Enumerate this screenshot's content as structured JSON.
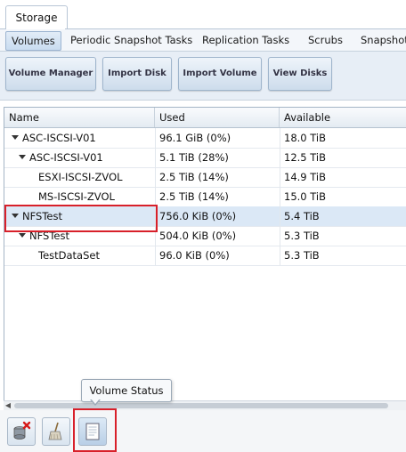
{
  "outer_tab": {
    "label": "Storage"
  },
  "sub_tabs": [
    {
      "label": "Volumes",
      "active": true
    },
    {
      "label": "Periodic Snapshot Tasks",
      "active": false
    },
    {
      "label": "Replication Tasks",
      "active": false
    },
    {
      "label": "Scrubs",
      "active": false
    },
    {
      "label": "Snapshots",
      "active": false
    }
  ],
  "toolbar": {
    "buttons": [
      {
        "label": "Volume Manager"
      },
      {
        "label": "Import Disk"
      },
      {
        "label": "Import Volume"
      },
      {
        "label": "View Disks"
      }
    ]
  },
  "grid": {
    "columns": [
      "Name",
      "Used",
      "Available"
    ],
    "rows": [
      {
        "name": "ASC-ISCSI-V01",
        "used": "96.1 GiB (0%)",
        "available": "18.0 TiB",
        "expander": true,
        "selected": false
      },
      {
        "name": "ASC-ISCSI-V01",
        "used": "5.1 TiB (28%)",
        "available": "12.5 TiB",
        "expander": true,
        "selected": false
      },
      {
        "name": "ESXI-ISCSI-ZVOL",
        "used": "2.5 TiB (14%)",
        "available": "14.9 TiB",
        "expander": false,
        "selected": false
      },
      {
        "name": "MS-ISCSI-ZVOL",
        "used": "2.5 TiB (14%)",
        "available": "15.0 TiB",
        "expander": false,
        "selected": false
      },
      {
        "name": "NFSTest",
        "used": "756.0 KiB (0%)",
        "available": "5.4 TiB",
        "expander": true,
        "selected": true
      },
      {
        "name": "NFSTest",
        "used": "504.0 KiB (0%)",
        "available": "5.3 TiB",
        "expander": true,
        "selected": false
      },
      {
        "name": "TestDataSet",
        "used": "96.0 KiB (0%)",
        "available": "5.3 TiB",
        "expander": false,
        "selected": false
      }
    ]
  },
  "tooltip": {
    "text": "Volume Status"
  },
  "bottom_actions": [
    {
      "icon": "detach-volume-icon"
    },
    {
      "icon": "scrub-volume-icon"
    },
    {
      "icon": "volume-status-icon"
    }
  ],
  "highlight_color": "#d8202a"
}
